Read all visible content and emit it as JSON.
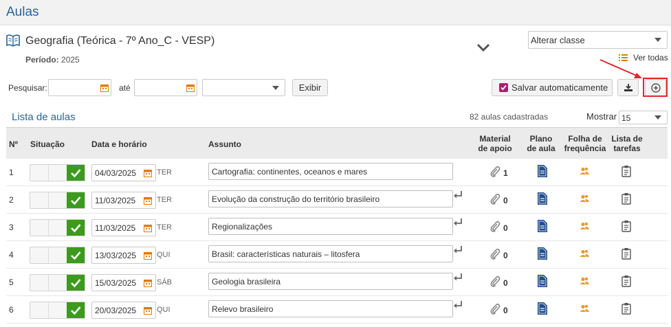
{
  "header": {
    "title": "Aulas"
  },
  "class_info": {
    "name": "Geografia (Teórica - 7º Ano_C - VESP)",
    "periodo_label": "Período:",
    "periodo_value": "2025"
  },
  "alterar_select": {
    "selected": "Alterar classe"
  },
  "ver_todas": {
    "label": "Ver todas"
  },
  "filters": {
    "search_label": "Pesquisar:",
    "ate_label": "até",
    "exibir_label": "Exibir"
  },
  "actions": {
    "salvar_label": "Salvar automaticamente",
    "salvar_checked": true
  },
  "list": {
    "title": "Lista de aulas",
    "count": "82 aulas cadastradas",
    "mostrar_label": "Mostrar",
    "mostrar_value": "15"
  },
  "columns": {
    "num": "Nº",
    "situacao": "Situação",
    "data": "Data e horário",
    "assunto": "Assunto",
    "material_1": "Material",
    "material_2": "de apoio",
    "plano_1": "Plano",
    "plano_2": "de aula",
    "folha_1": "Folha de",
    "folha_2": "frequência",
    "lista_1": "Lista de",
    "lista_2": "tarefas"
  },
  "rows": [
    {
      "num": "1",
      "date": "04/03/2025",
      "dow": "TER",
      "subject": "Cartografia: continentes, oceanos e mares",
      "material": "1"
    },
    {
      "num": "2",
      "date": "11/03/2025",
      "dow": "TER",
      "subject": "Evolução da construção do território brasileiro",
      "material": "0"
    },
    {
      "num": "3",
      "date": "11/03/2025",
      "dow": "TER",
      "subject": "Regionalizações",
      "material": "0"
    },
    {
      "num": "4",
      "date": "13/03/2025",
      "dow": "QUI",
      "subject": "Brasil: características naturais – litosfera",
      "material": "0"
    },
    {
      "num": "5",
      "date": "15/03/2025",
      "dow": "SÁB",
      "subject": "Geologia brasileira",
      "material": "0"
    },
    {
      "num": "6",
      "date": "20/03/2025",
      "dow": "QUI",
      "subject": "Relevo brasileiro",
      "material": "0"
    }
  ],
  "colors": {
    "title_blue": "#2a6496",
    "check_green": "#3c9a1e",
    "calendar_orange": "#e07b00",
    "plano_blue": "#1f4e8c",
    "annotation_red": "#e2262e"
  }
}
